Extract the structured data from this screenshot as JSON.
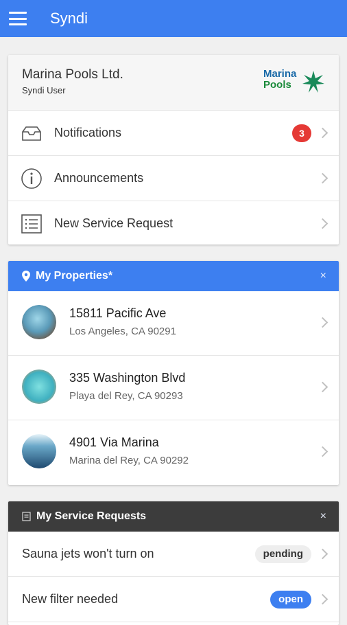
{
  "app": {
    "title": "Syndi"
  },
  "account": {
    "company": "Marina Pools Ltd.",
    "user": "Syndi User",
    "logo": {
      "line1": "Marina",
      "line2": "Pools"
    }
  },
  "menu": [
    {
      "label": "Notifications",
      "icon": "inbox-icon",
      "badge": "3"
    },
    {
      "label": "Announcements",
      "icon": "info-icon"
    },
    {
      "label": "New Service Request",
      "icon": "list-icon"
    }
  ],
  "properties": {
    "title": "My Properties*",
    "close": "×",
    "items": [
      {
        "street": "15811 Pacific Ave",
        "city": "Los Angeles, CA 90291"
      },
      {
        "street": "335 Washington Blvd",
        "city": "Playa del Rey, CA 90293"
      },
      {
        "street": "4901 Via Marina",
        "city": "Marina del Rey, CA 90292"
      }
    ]
  },
  "requests": {
    "title": "My Service Requests",
    "close": "×",
    "items": [
      {
        "title": "Sauna jets won't turn on",
        "status": "pending"
      },
      {
        "title": "New filter needed",
        "status": "open"
      }
    ]
  },
  "colors": {
    "primary": "#3d7ff0",
    "badge": "#e53935",
    "dark_header": "#3c3c3c"
  }
}
